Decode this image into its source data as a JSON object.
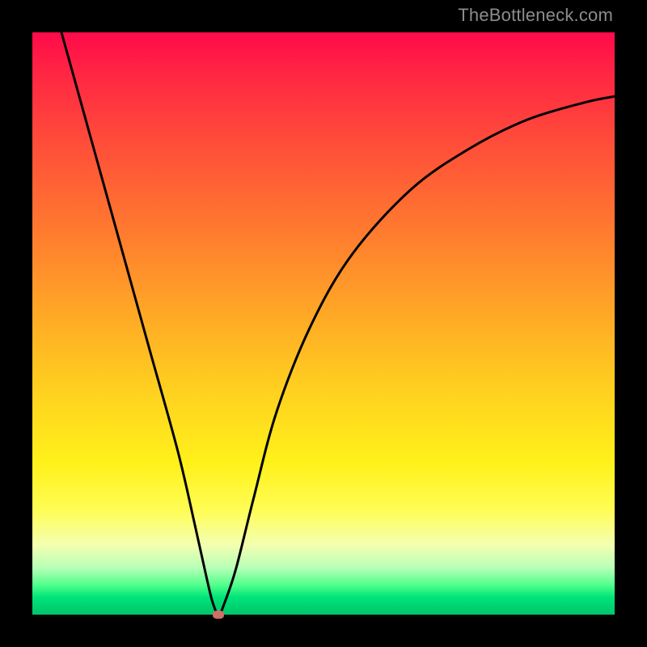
{
  "watermark": "TheBottleneck.com",
  "chart_data": {
    "type": "line",
    "title": "",
    "xlabel": "",
    "ylabel": "",
    "xlim": [
      0,
      100
    ],
    "ylim": [
      0,
      100
    ],
    "grid": false,
    "series": [
      {
        "name": "curve",
        "x": [
          5,
          10,
          15,
          20,
          25,
          28,
          30,
          31,
          32,
          33,
          35,
          38,
          42,
          48,
          55,
          65,
          75,
          85,
          95,
          100
        ],
        "y": [
          100,
          82,
          64,
          46,
          28,
          15,
          6,
          2,
          0,
          2,
          8,
          20,
          35,
          50,
          62,
          73,
          80,
          85,
          88,
          89
        ]
      }
    ],
    "marker": {
      "x": 32,
      "y": 0
    },
    "background_gradient": {
      "stops": [
        {
          "pos": 0,
          "color": "#ff0a4a"
        },
        {
          "pos": 50,
          "color": "#ffa726"
        },
        {
          "pos": 78,
          "color": "#fff11a"
        },
        {
          "pos": 94,
          "color": "#4dff8a"
        },
        {
          "pos": 100,
          "color": "#00c46a"
        }
      ]
    }
  }
}
